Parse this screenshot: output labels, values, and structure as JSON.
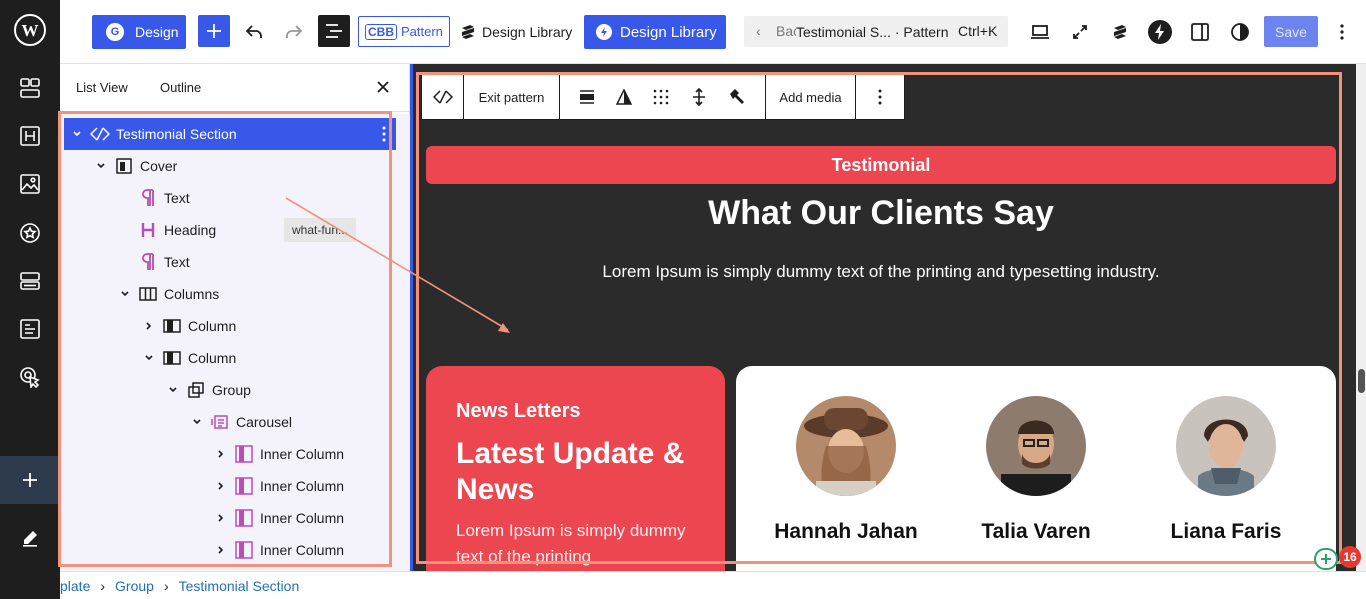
{
  "topbar": {
    "design_label": "Design",
    "pattern_badge": "CBB",
    "pattern_label": "Pattern",
    "design_library_label": "Design Library",
    "design_library_btn_label": "Design Library",
    "back_label": "Back",
    "doc_title": "Testimonial S... · Pattern",
    "shortcut": "Ctrl+K",
    "save_label": "Save"
  },
  "listview": {
    "tab_list": "List View",
    "tab_outline": "Outline",
    "items": [
      {
        "label": "Testimonial Section",
        "icon": "pattern-icon"
      },
      {
        "label": "Cover",
        "icon": "cover-icon"
      },
      {
        "label": "Text",
        "icon": "paragraph-icon"
      },
      {
        "label": "Heading",
        "icon": "heading-icon",
        "anchor": "what-fun..."
      },
      {
        "label": "Text",
        "icon": "paragraph-icon"
      },
      {
        "label": "Columns",
        "icon": "columns-icon"
      },
      {
        "label": "Column",
        "icon": "column-icon"
      },
      {
        "label": "Column",
        "icon": "column-icon"
      },
      {
        "label": "Group",
        "icon": "group-icon"
      },
      {
        "label": "Carousel",
        "icon": "carousel-icon"
      },
      {
        "label": "Inner Column",
        "icon": "inner-column-icon"
      },
      {
        "label": "Inner Column",
        "icon": "inner-column-icon"
      },
      {
        "label": "Inner Column",
        "icon": "inner-column-icon"
      },
      {
        "label": "Inner Column",
        "icon": "inner-column-icon"
      }
    ]
  },
  "block_toolbar": {
    "exit_label": "Exit pattern",
    "add_media_label": "Add media"
  },
  "canvas": {
    "badge": "Testimonial",
    "title": "What Our Clients Say",
    "subtitle": "Lorem Ipsum is simply dummy text of the printing and typesetting industry.",
    "news": {
      "kicker": "News Letters",
      "title": "Latest Update & News",
      "body": "Lorem Ipsum is simply dummy text of the printing"
    },
    "people": [
      {
        "name": "Hannah Jahan"
      },
      {
        "name": "Talia Varen"
      },
      {
        "name": "Liana Faris"
      }
    ]
  },
  "notification_count": "16",
  "breadcrumb": [
    "plate",
    "Group",
    "Testimonial Section"
  ],
  "colors": {
    "accent": "#3858e9",
    "brand_red": "#ec4750",
    "canvas_bg": "#2b2b2b",
    "highlight": "#f0937a"
  }
}
